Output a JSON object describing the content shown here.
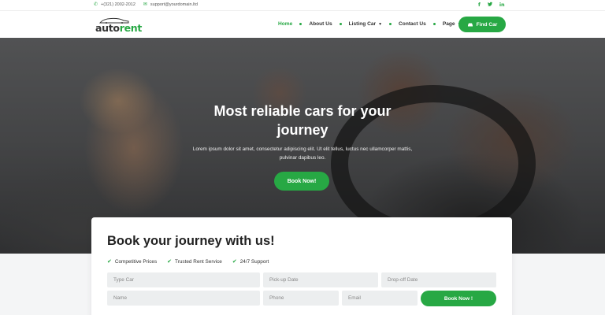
{
  "topbar": {
    "phone": "+(321) 2002-2012",
    "email": "support@yourdomain.ltd",
    "social": [
      "f",
      "🐦",
      "in"
    ]
  },
  "header": {
    "logo": {
      "part1": "auto",
      "part2": "rent"
    },
    "nav": [
      {
        "label": "Home",
        "active": true,
        "dropdown": false
      },
      {
        "label": "About Us",
        "active": false,
        "dropdown": false
      },
      {
        "label": "Listing Car",
        "active": false,
        "dropdown": true
      },
      {
        "label": "Contact Us",
        "active": false,
        "dropdown": false
      },
      {
        "label": "Page",
        "active": false,
        "dropdown": true
      }
    ],
    "find_car_label": "Find Car"
  },
  "hero": {
    "title_line1": "Most reliable cars for your",
    "title_line2": "journey",
    "text": "Lorem ipsum dolor sit amet, consectetur adipiscing elit. Ut elit tellus, luctus nec ullamcorper mattis, pulvinar dapibus leo.",
    "button": "Book Now!"
  },
  "booking": {
    "title": "Book your journey with us!",
    "features": [
      "Competitive Prices",
      "Trusted Rent Service",
      "24/7 Support"
    ],
    "fields": {
      "type_car": "Type Car",
      "pickup": "Pick-up Date",
      "dropoff": "Drop-off Date",
      "name": "Name",
      "phone": "Phone",
      "email": "Email"
    },
    "submit": "Book Now !"
  },
  "colors": {
    "accent": "#27a844",
    "text": "#222222"
  }
}
